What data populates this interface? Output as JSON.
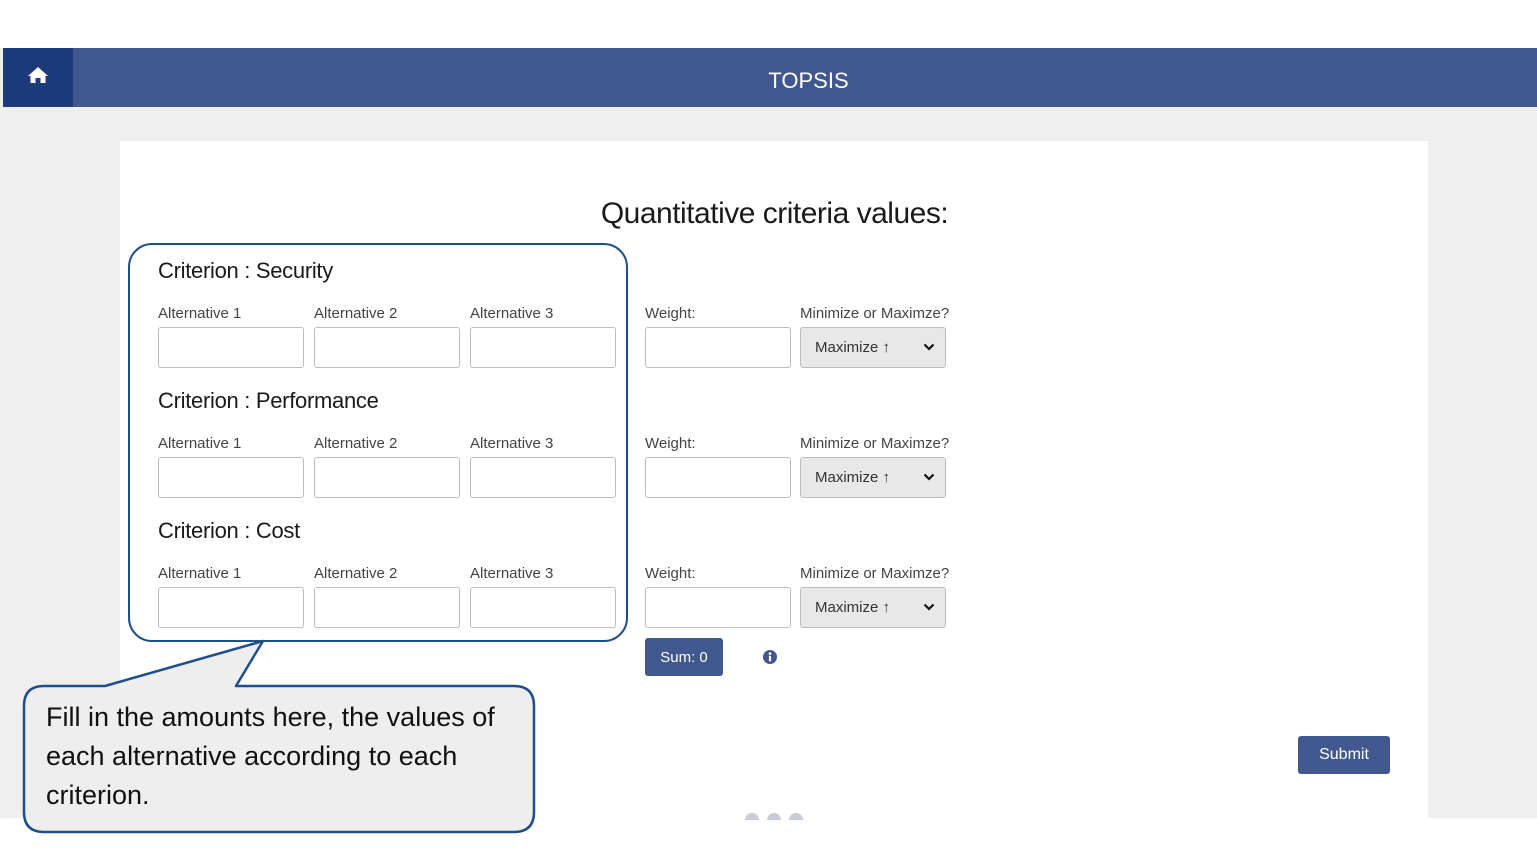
{
  "header": {
    "title": "TOPSIS",
    "home_icon": "home-icon"
  },
  "page_heading": "Quantitative criteria values:",
  "criteria": [
    {
      "title": "Criterion : Security",
      "alt_labels": [
        "Alternative 1",
        "Alternative 2",
        "Alternative 3"
      ],
      "alt_values": [
        "",
        "",
        ""
      ],
      "weight_label": "Weight:",
      "weight_value": "",
      "direction_label": "Minimize or Maximze?",
      "direction_value": "Maximize ↑"
    },
    {
      "title": "Criterion : Performance",
      "alt_labels": [
        "Alternative 1",
        "Alternative 2",
        "Alternative 3"
      ],
      "alt_values": [
        "",
        "",
        ""
      ],
      "weight_label": "Weight:",
      "weight_value": "",
      "direction_label": "Minimize or Maximze?",
      "direction_value": "Maximize ↑"
    },
    {
      "title": "Criterion : Cost",
      "alt_labels": [
        "Alternative 1",
        "Alternative 2",
        "Alternative 3"
      ],
      "alt_values": [
        "",
        "",
        ""
      ],
      "weight_label": "Weight:",
      "weight_value": "",
      "direction_label": "Minimize or Maximze?",
      "direction_value": "Maximize ↑"
    }
  ],
  "sum_button": "Sum: 0",
  "submit_button": "Submit",
  "callout": {
    "text": "Fill in the amounts here, the values of each alternative according to each criterion."
  },
  "colors": {
    "header": "#41588f",
    "home_button": "#1d3b7a",
    "primary_button": "#41588f",
    "callout_border": "#1f4f8a"
  }
}
